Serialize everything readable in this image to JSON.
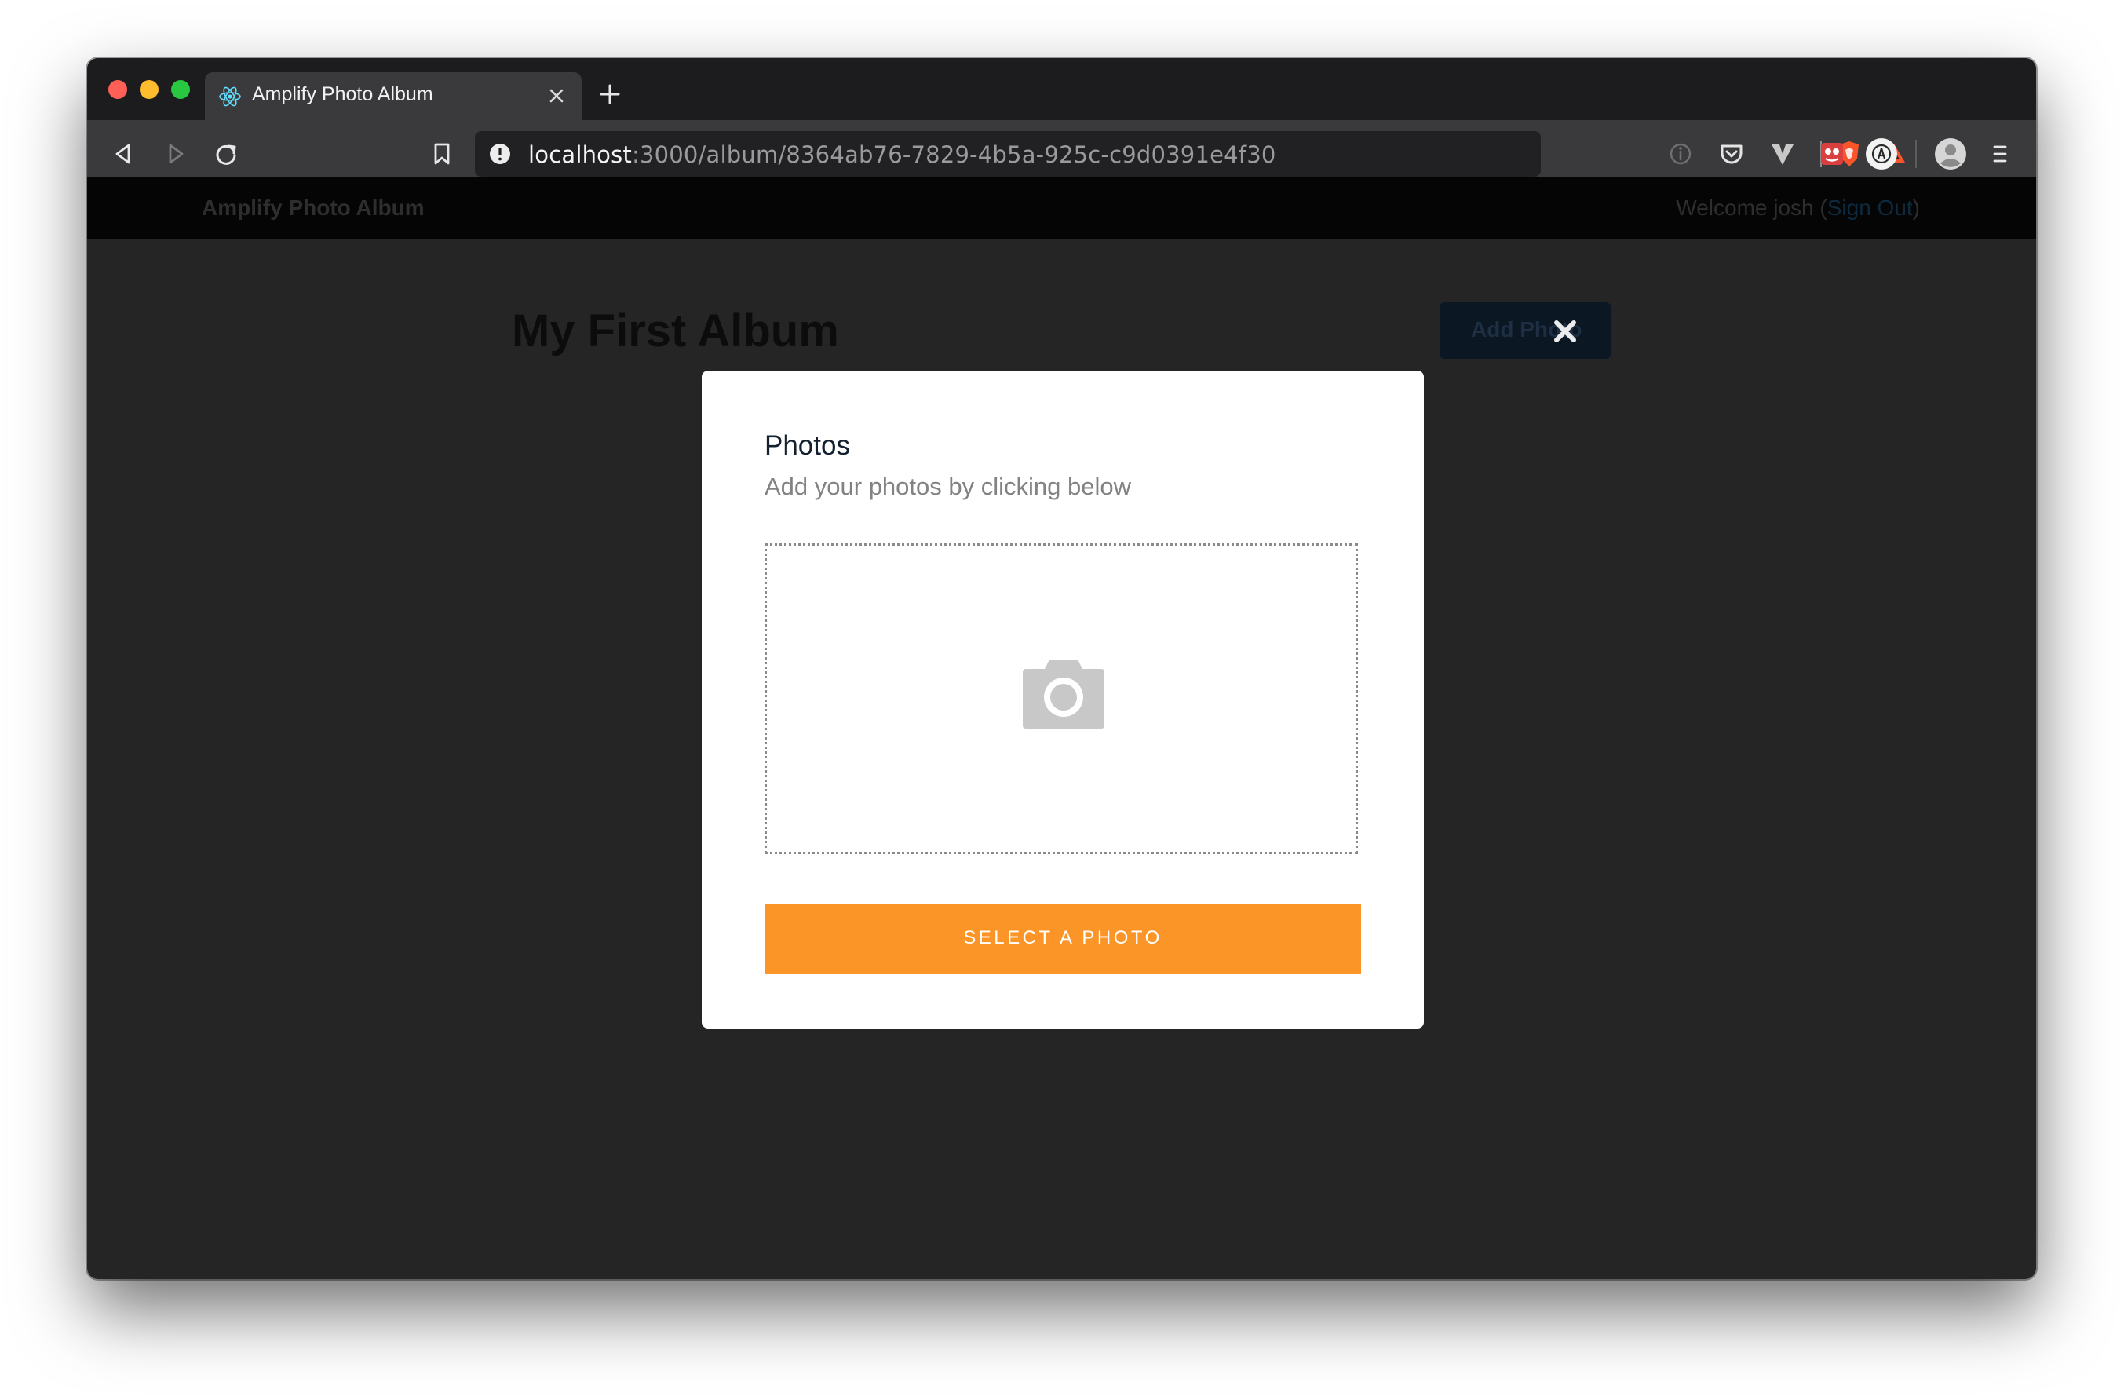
{
  "browser": {
    "tab": {
      "title": "Amplify Photo Album",
      "favicon": "react-logo-icon"
    },
    "address_bar": {
      "host": "localhost",
      "path": ":3000/album/8364ab76-7829-4b5a-925c-c9d0391e4f30"
    },
    "toolbar_icons": [
      "back-icon",
      "forward-icon",
      "reload-icon",
      "bookmark-icon",
      "brave-shield-icon",
      "brave-rewards-icon",
      "info-icon",
      "pocket-icon",
      "vivaldi-v-icon",
      "extension-icon",
      "amplify-extension-icon",
      "profile-icon",
      "menu-icon"
    ]
  },
  "app": {
    "brand": "Amplify Photo Album",
    "welcome": {
      "prefix": "Welcome josh (",
      "signout": "Sign Out",
      "suffix": ")"
    }
  },
  "album": {
    "title": "My First Album",
    "add_photo_label": "Add Photo"
  },
  "modal": {
    "title": "Photos",
    "subtitle": "Add your photos by clicking below",
    "dropzone_icon": "camera-icon",
    "select_button_label": "SELECT A PHOTO"
  },
  "colors": {
    "accent_button": "#fb9527",
    "page_background": "#252525",
    "modal_background": "#ffffff"
  }
}
